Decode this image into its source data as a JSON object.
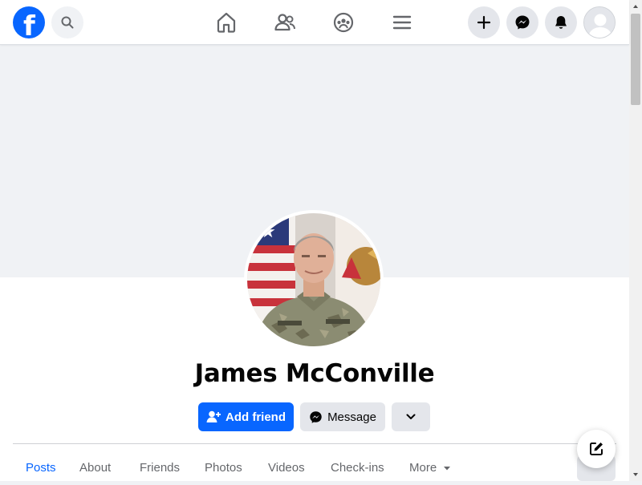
{
  "profile": {
    "name": "James McConville"
  },
  "actions": {
    "add_friend": "Add friend",
    "message": "Message"
  },
  "tabs": [
    {
      "label": "Posts"
    },
    {
      "label": "About"
    },
    {
      "label": "Friends"
    },
    {
      "label": "Photos"
    },
    {
      "label": "Videos"
    },
    {
      "label": "Check-ins"
    },
    {
      "label": "More"
    }
  ],
  "colors": {
    "brand": "#0866ff",
    "button_gray": "#e4e6eb",
    "background": "#f0f2f5"
  },
  "icons": {
    "logo": "facebook-logo",
    "search": "search-icon",
    "home": "home-icon",
    "friends": "friends-icon",
    "groups": "groups-icon",
    "menu": "menu-icon",
    "create": "plus-icon",
    "messenger": "messenger-icon",
    "notifications": "bell-icon",
    "account": "account-avatar",
    "compose": "compose-icon"
  }
}
